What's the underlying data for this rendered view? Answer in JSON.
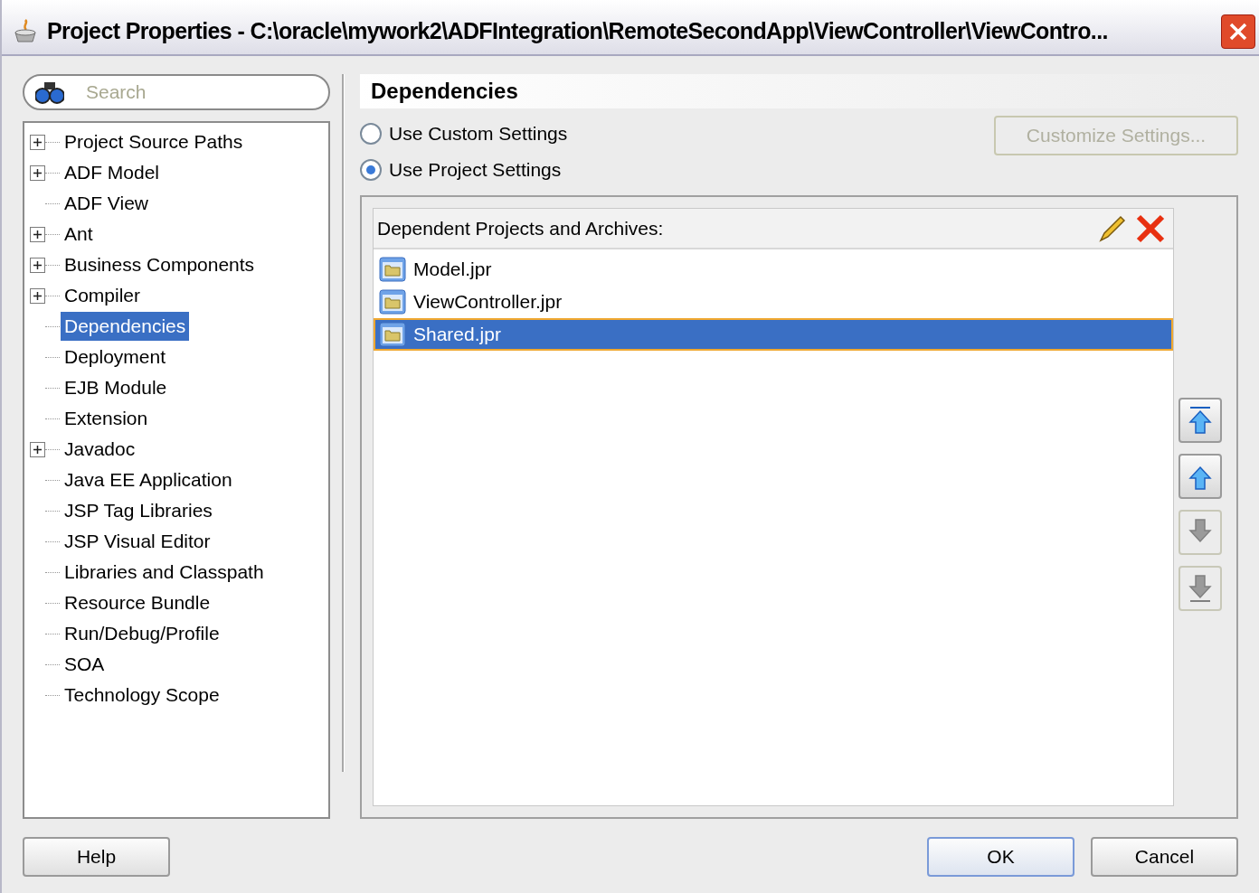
{
  "window": {
    "title": "Project Properties - C:\\oracle\\mywork2\\ADFIntegration\\RemoteSecondApp\\ViewController\\ViewContro..."
  },
  "search": {
    "placeholder": "Search"
  },
  "tree": [
    {
      "label": "Project Source Paths",
      "expandable": true,
      "selected": false
    },
    {
      "label": "ADF Model",
      "expandable": true,
      "selected": false
    },
    {
      "label": "ADF View",
      "expandable": false,
      "selected": false
    },
    {
      "label": "Ant",
      "expandable": true,
      "selected": false
    },
    {
      "label": "Business Components",
      "expandable": true,
      "selected": false
    },
    {
      "label": "Compiler",
      "expandable": true,
      "selected": false
    },
    {
      "label": "Dependencies",
      "expandable": false,
      "selected": true
    },
    {
      "label": "Deployment",
      "expandable": false,
      "selected": false
    },
    {
      "label": "EJB Module",
      "expandable": false,
      "selected": false
    },
    {
      "label": "Extension",
      "expandable": false,
      "selected": false
    },
    {
      "label": "Javadoc",
      "expandable": true,
      "selected": false
    },
    {
      "label": "Java EE Application",
      "expandable": false,
      "selected": false
    },
    {
      "label": "JSP Tag Libraries",
      "expandable": false,
      "selected": false
    },
    {
      "label": "JSP Visual Editor",
      "expandable": false,
      "selected": false
    },
    {
      "label": "Libraries and Classpath",
      "expandable": false,
      "selected": false
    },
    {
      "label": "Resource Bundle",
      "expandable": false,
      "selected": false
    },
    {
      "label": "Run/Debug/Profile",
      "expandable": false,
      "selected": false
    },
    {
      "label": "SOA",
      "expandable": false,
      "selected": false
    },
    {
      "label": "Technology Scope",
      "expandable": false,
      "selected": false
    }
  ],
  "panel": {
    "title": "Dependencies",
    "options": [
      {
        "label": "Use Custom Settings",
        "selected": false
      },
      {
        "label": "Use Project Settings",
        "selected": true
      }
    ],
    "customize_button": {
      "label": "Customize Settings...",
      "disabled": true
    },
    "list_title": "Dependent Projects and Archives:",
    "items": [
      {
        "label": "Model.jpr",
        "selected": false
      },
      {
        "label": "ViewController.jpr",
        "selected": false
      },
      {
        "label": "Shared.jpr",
        "selected": true
      }
    ],
    "move_buttons": [
      {
        "kind": "top",
        "disabled": false
      },
      {
        "kind": "up",
        "disabled": false
      },
      {
        "kind": "down",
        "disabled": true
      },
      {
        "kind": "bottom",
        "disabled": true
      }
    ]
  },
  "buttons": {
    "help": "Help",
    "ok": "OK",
    "cancel": "Cancel"
  }
}
